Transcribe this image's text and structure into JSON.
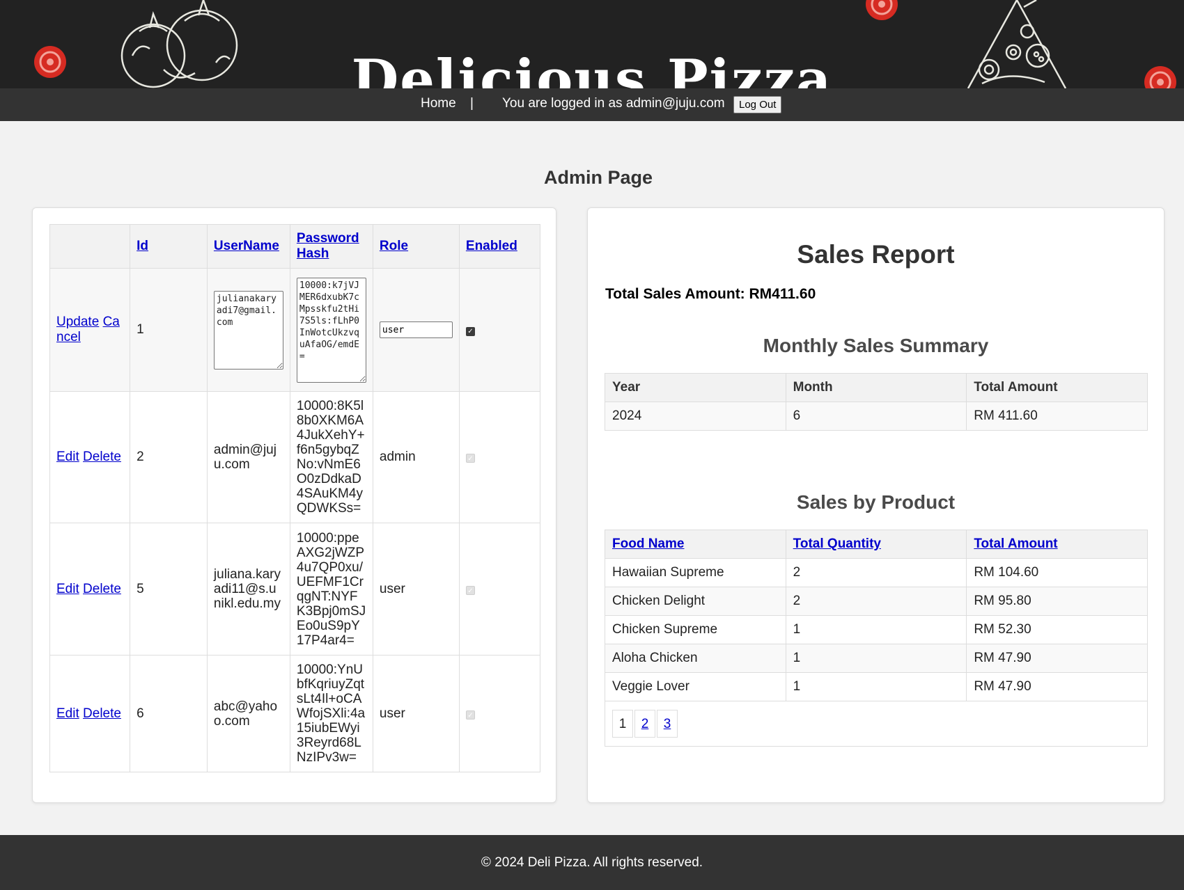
{
  "header": {
    "title": "Delicious Pizza"
  },
  "nav": {
    "home_label": "Home",
    "separator": "|",
    "logged_in_text": "You are logged in as admin@juju.com",
    "logout_label": "Log Out"
  },
  "page": {
    "title": "Admin Page"
  },
  "users": {
    "columns": [
      "",
      "Id",
      "UserName",
      "Password Hash",
      "Role",
      "Enabled"
    ],
    "edit_row": {
      "update_label": "Update",
      "cancel_label": "Cancel",
      "id": "1",
      "username": "julianakaryadi7@gmail.com",
      "password_hash": "10000:k7jVJMER6dxubK7cMpsskfu2tHi7S5ls:fLhP0InWotcUkzvquAfaOG/emdE=",
      "role": "user",
      "enabled": true
    },
    "rows": [
      {
        "edit_label": "Edit",
        "delete_label": "Delete",
        "id": "2",
        "username": "admin@juju.com",
        "password_hash": "10000:8K5l8b0XKM6A4JukXehY+f6n5gybqZNo:vNmE6O0zDdkaD4SAuKM4yQDWKSs=",
        "role": "admin",
        "enabled": true
      },
      {
        "edit_label": "Edit",
        "delete_label": "Delete",
        "id": "5",
        "username": "juliana.karyadi11@s.unikl.edu.my",
        "password_hash": "10000:ppeAXG2jWZP4u7QP0xu/UEFMF1CrqgNT:NYFK3Bpj0mSJEo0uS9pY17P4ar4=",
        "role": "user",
        "enabled": true
      },
      {
        "edit_label": "Edit",
        "delete_label": "Delete",
        "id": "6",
        "username": "abc@yahoo.com",
        "password_hash": "10000:YnUbfKqriuyZqtsLt4Il+oCAWfojSXli:4a15iubEWyi3Reyrd68LNzIPv3w=",
        "role": "user",
        "enabled": true
      }
    ]
  },
  "sales": {
    "title": "Sales Report",
    "total_label": "Total Sales Amount: RM411.60",
    "monthly": {
      "title": "Monthly Sales Summary",
      "columns": [
        "Year",
        "Month",
        "Total Amount"
      ],
      "rows": [
        [
          "2024",
          "6",
          "RM 411.60"
        ]
      ]
    },
    "by_product": {
      "title": "Sales by Product",
      "columns": [
        "Food Name",
        "Total Quantity",
        "Total Amount"
      ],
      "rows": [
        [
          "Hawaiian Supreme",
          "2",
          "RM 104.60"
        ],
        [
          "Chicken Delight",
          "2",
          "RM 95.80"
        ],
        [
          "Chicken Supreme",
          "1",
          "RM 52.30"
        ],
        [
          "Aloha Chicken",
          "1",
          "RM 47.90"
        ],
        [
          "Veggie Lover",
          "1",
          "RM 47.90"
        ]
      ],
      "pages": [
        "1",
        "2",
        "3"
      ]
    }
  },
  "footer": {
    "text": "© 2024 Deli Pizza. All rights reserved."
  },
  "colors": {
    "header_bg": "#222222",
    "nav_bg": "#333333",
    "link": "#0000cc",
    "tomato": "#d62b22"
  },
  "icons": [
    "tomato-slice-icon",
    "tomatoes-sketch-icon",
    "pizza-slice-sketch-icon",
    "checkbox-checked-icon"
  ]
}
